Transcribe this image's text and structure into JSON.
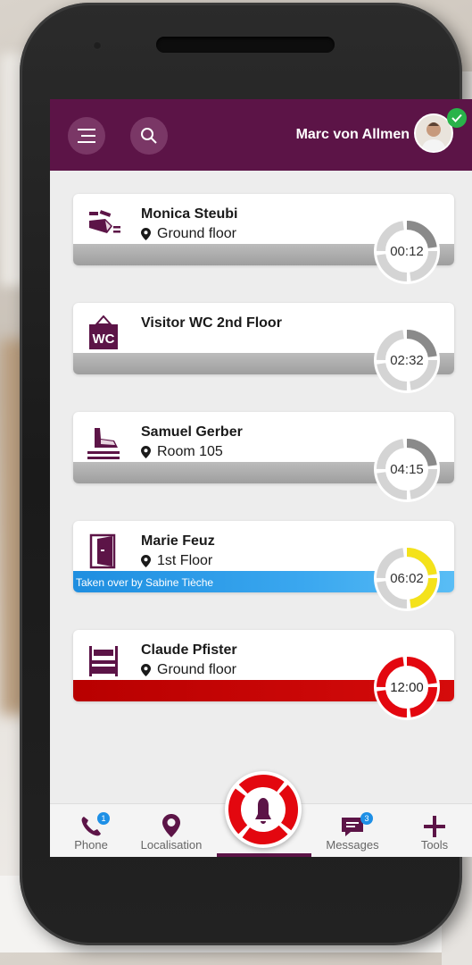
{
  "header": {
    "user_name": "Marc von Allmen",
    "status_color": "#29b34a",
    "bg_color": "#5c1447"
  },
  "alerts": [
    {
      "title": "Monica Steubi",
      "location": "Ground floor",
      "timer": "00:12",
      "icon": "fall-person-icon",
      "status_bar": "",
      "state": "grey"
    },
    {
      "title": "Visitor WC 2nd Floor",
      "location": "",
      "timer": "02:32",
      "icon": "wc-sign-icon",
      "status_bar": "",
      "state": "grey"
    },
    {
      "title": "Samuel Gerber",
      "location": "Room 105",
      "timer": "04:15",
      "icon": "shoe-step-icon",
      "status_bar": "",
      "state": "grey"
    },
    {
      "title": "Marie Feuz",
      "location": "1st Floor",
      "timer": "06:02",
      "icon": "door-icon",
      "status_bar": "Taken over by Sabine Tièche",
      "state": "taken"
    },
    {
      "title": "Claude Pfister",
      "location": "Ground floor",
      "timer": "12:00",
      "icon": "bed-icon",
      "status_bar": "",
      "state": "critical"
    }
  ],
  "tabs": [
    {
      "label": "Phone",
      "icon": "phone-icon",
      "badge": "1"
    },
    {
      "label": "Localisation",
      "icon": "location-pin-icon",
      "badge": ""
    },
    {
      "label": "Messages",
      "icon": "message-icon",
      "badge": "3"
    },
    {
      "label": "Tools",
      "icon": "plus-icon",
      "badge": ""
    }
  ],
  "colors": {
    "grey_timer": "#8a8a8a",
    "yellow_timer": "#f4e21a",
    "red_timer": "#e3070f",
    "blue_bar": "#2a9bea"
  }
}
